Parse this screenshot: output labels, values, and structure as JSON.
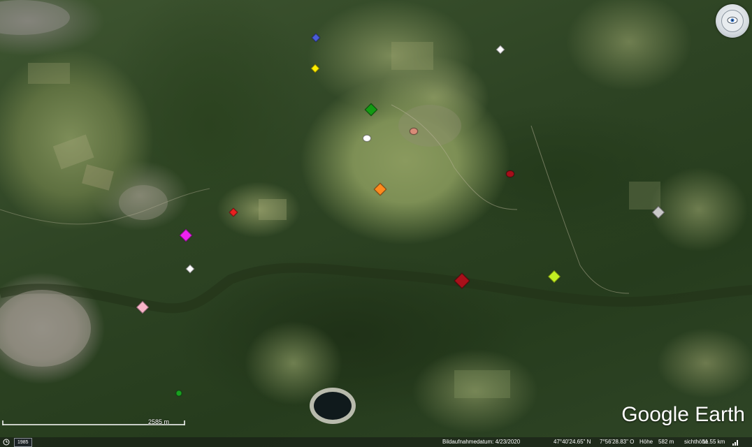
{
  "brand": {
    "logo_text": "Google Earth"
  },
  "controls": {
    "navigation": "navigation-compass-icon"
  },
  "scale": {
    "label": "2585 m"
  },
  "status_bar": {
    "year": "1985",
    "imagery_date": "Bildaufnahmedatum: 4/23/2020",
    "latitude": "47°40'24.65\" N",
    "longitude": "7°56'28.83\" O",
    "elevation_label": "Höhe",
    "elevation": "582 m",
    "eye_alt_label": "sichthöhe",
    "eye_alt": "11.55 km"
  },
  "markers": [
    {
      "id": "blue",
      "color": "#4a5cd8",
      "shape": "diamond"
    },
    {
      "id": "white-top",
      "color": "#ffffff",
      "shape": "diamond"
    },
    {
      "id": "yellow",
      "color": "#ffee00",
      "shape": "diamond"
    },
    {
      "id": "green",
      "color": "#139a13",
      "shape": "diamond"
    },
    {
      "id": "salmon",
      "color": "#d98c78",
      "shape": "dot"
    },
    {
      "id": "white-dot",
      "color": "#ffffff",
      "shape": "dot"
    },
    {
      "id": "dark-red-dot",
      "color": "#a50f1a",
      "shape": "dot"
    },
    {
      "id": "orange",
      "color": "#ff8a1e",
      "shape": "diamond"
    },
    {
      "id": "red",
      "color": "#e82020",
      "shape": "diamond"
    },
    {
      "id": "magenta",
      "color": "#ee22ee",
      "shape": "diamond"
    },
    {
      "id": "silver",
      "color": "#c8c8c8",
      "shape": "diamond"
    },
    {
      "id": "white-mid",
      "color": "#ffffff",
      "shape": "diamond"
    },
    {
      "id": "maroon",
      "color": "#a8101a",
      "shape": "diamond"
    },
    {
      "id": "lime",
      "color": "#c2ee22",
      "shape": "diamond"
    },
    {
      "id": "pink",
      "color": "#f8b4c8",
      "shape": "diamond"
    },
    {
      "id": "small-green",
      "color": "#19a020",
      "shape": "dot"
    }
  ]
}
